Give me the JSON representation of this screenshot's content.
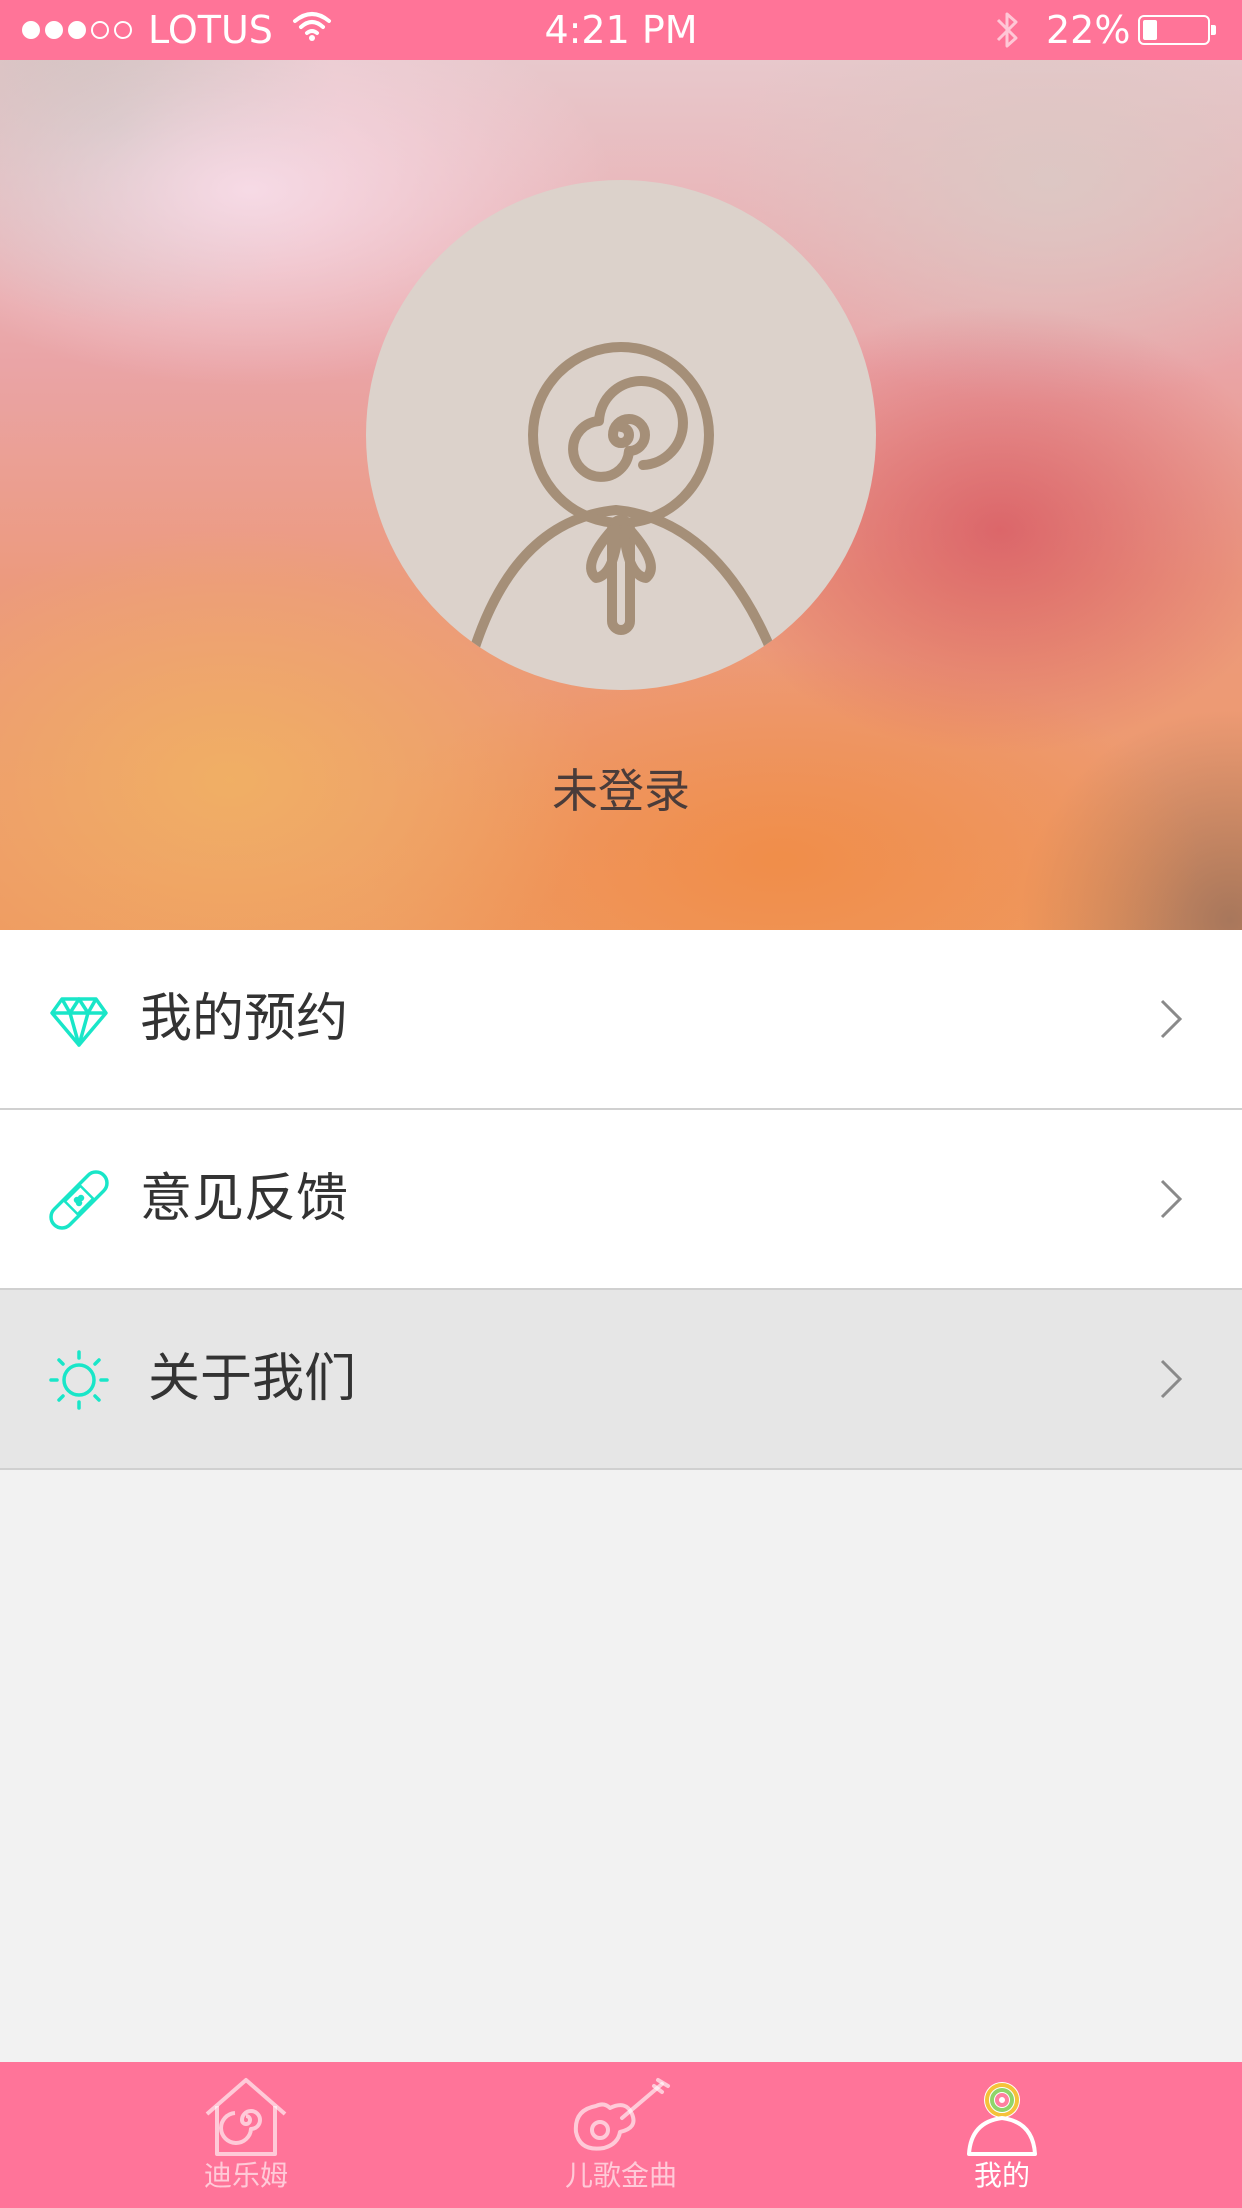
{
  "status_bar": {
    "carrier": "LOTUS",
    "time": "4:21 PM",
    "battery_percent": "22%",
    "battery_level": 0.22,
    "signal_bars_filled": 3,
    "signal_bars_total": 5
  },
  "profile": {
    "login_status": "未登录",
    "avatar_icon": "lollipop-avatar-icon"
  },
  "menu": {
    "items": [
      {
        "label": "我的预约",
        "icon": "diamond-icon"
      },
      {
        "label": "意见反馈",
        "icon": "bandage-icon"
      },
      {
        "label": "关于我们",
        "icon": "sun-icon"
      }
    ]
  },
  "tab_bar": {
    "tabs": [
      {
        "label": "迪乐姆",
        "icon": "house-icon",
        "active": false
      },
      {
        "label": "儿歌金曲",
        "icon": "violin-icon",
        "active": false
      },
      {
        "label": "我的",
        "icon": "profile-icon",
        "active": true
      }
    ]
  },
  "colors": {
    "brand_pink": "#ff7498",
    "accent_cyan": "#19e6c8",
    "avatar_stroke": "#a58f78"
  }
}
